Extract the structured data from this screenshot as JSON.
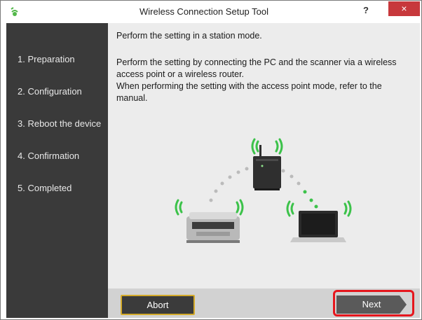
{
  "window": {
    "title": "Wireless Connection Setup Tool",
    "help_label": "?",
    "close_label": "×"
  },
  "sidebar": {
    "steps": [
      {
        "label": "1. Preparation"
      },
      {
        "label": "2. Configuration"
      },
      {
        "label": "3. Reboot the device"
      },
      {
        "label": "4. Confirmation"
      },
      {
        "label": "5. Completed"
      }
    ]
  },
  "main": {
    "heading": "Perform the setting in a station mode.",
    "line1": "Perform the setting by connecting the PC and the scanner via a wireless",
    "line2": "access point or a wireless router.",
    "line3": "When performing the setting with the access point mode, refer to the",
    "line4": "manual."
  },
  "footer": {
    "abort_label": "Abort",
    "next_label": "Next"
  },
  "colors": {
    "sidebar_bg": "#3a3a3a",
    "content_bg": "#ececec",
    "accent_gold": "#d4aa2a",
    "wifi_green": "#3cc24a",
    "highlight_red": "#e6161d",
    "close_red": "#c7383c"
  },
  "icons": {
    "app": "app-icon",
    "router": "router-icon",
    "scanner": "scanner-icon",
    "laptop": "laptop-icon",
    "wifi": "wifi-signal-icon"
  }
}
